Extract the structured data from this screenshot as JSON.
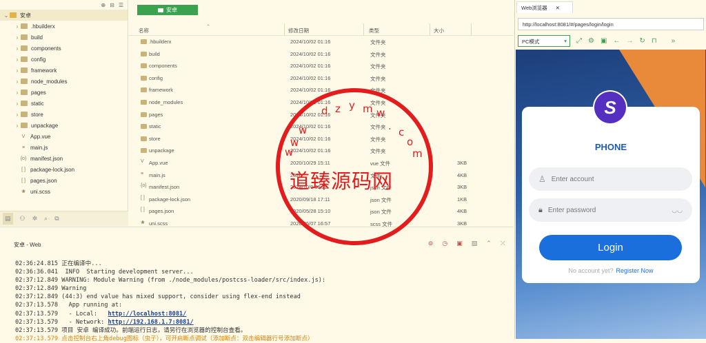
{
  "left_tree": {
    "root": "安卓",
    "items": [
      {
        "name": ".hbuilderx",
        "type": "folder"
      },
      {
        "name": "build",
        "type": "folder"
      },
      {
        "name": "components",
        "type": "folder"
      },
      {
        "name": "config",
        "type": "folder"
      },
      {
        "name": "framework",
        "type": "folder"
      },
      {
        "name": "node_modules",
        "type": "folder"
      },
      {
        "name": "pages",
        "type": "folder"
      },
      {
        "name": "static",
        "type": "folder"
      },
      {
        "name": "store",
        "type": "folder"
      },
      {
        "name": "unpackage",
        "type": "folder"
      },
      {
        "name": "App.vue",
        "type": "file",
        "icon": "V"
      },
      {
        "name": "main.js",
        "type": "file",
        "icon": "≡"
      },
      {
        "name": "manifest.json",
        "type": "file",
        "icon": "{o}"
      },
      {
        "name": "package-lock.json",
        "type": "file",
        "icon": "[ ]"
      },
      {
        "name": "pages.json",
        "type": "file",
        "icon": "[ ]"
      },
      {
        "name": "uni.scss",
        "type": "file",
        "icon": "❀"
      }
    ]
  },
  "center": {
    "tab_label": "安卓",
    "columns": {
      "name": "名称",
      "date": "修改日期",
      "type": "类型",
      "size": "大小"
    },
    "rows": [
      {
        "name": ".hbuilderx",
        "date": "2024/10/02 01:16",
        "type": "文件夹",
        "size": "",
        "kind": "folder"
      },
      {
        "name": "build",
        "date": "2024/10/02 01:16",
        "type": "文件夹",
        "size": "",
        "kind": "folder"
      },
      {
        "name": "components",
        "date": "2024/10/02 01:16",
        "type": "文件夹",
        "size": "",
        "kind": "folder"
      },
      {
        "name": "config",
        "date": "2024/10/02 01:16",
        "type": "文件夹",
        "size": "",
        "kind": "folder"
      },
      {
        "name": "framework",
        "date": "2024/10/02 01:16",
        "type": "文件夹",
        "size": "",
        "kind": "folder"
      },
      {
        "name": "node_modules",
        "date": "2024/10/02 01:16",
        "type": "文件夹",
        "size": "",
        "kind": "folder"
      },
      {
        "name": "pages",
        "date": "2024/10/02 01:16",
        "type": "文件夹",
        "size": "",
        "kind": "folder"
      },
      {
        "name": "static",
        "date": "2024/10/02 01:16",
        "type": "文件夹",
        "size": "",
        "kind": "folder"
      },
      {
        "name": "store",
        "date": "2024/10/02 01:16",
        "type": "文件夹",
        "size": "",
        "kind": "folder"
      },
      {
        "name": "unpackage",
        "date": "2024/10/02 01:16",
        "type": "文件夹",
        "size": "",
        "kind": "folder"
      },
      {
        "name": "App.vue",
        "date": "2020/10/29 15:11",
        "type": "vue 文件",
        "size": "3KB",
        "kind": "file",
        "icon": "V"
      },
      {
        "name": "main.js",
        "date": "2020/",
        "type": "文件",
        "size": "4KB",
        "kind": "file",
        "icon": "≡"
      },
      {
        "name": "manifest.json",
        "date": "2024/10/0 03:22",
        "type": "json 文件",
        "size": "3KB",
        "kind": "file",
        "icon": "{o}"
      },
      {
        "name": "package-lock.json",
        "date": "2020/09/18 17:11",
        "type": "json 文件",
        "size": "1KB",
        "kind": "file",
        "icon": "[ ]"
      },
      {
        "name": "pages.json",
        "date": "2020/05/28 15:10",
        "type": "json 文件",
        "size": "4KB",
        "kind": "file",
        "icon": "[ ]"
      },
      {
        "name": "uni.scss",
        "date": "2020/05/07 16:57",
        "type": "scss 文件",
        "size": "3KB",
        "kind": "file",
        "icon": "❀"
      }
    ]
  },
  "console": {
    "title": "安卓 - Web",
    "lines": [
      {
        "t": "02:36:24.815",
        "msg": " 正在编译中..."
      },
      {
        "t": "02:36:36.041",
        "msg": "  INFO  Starting development server..."
      },
      {
        "t": "02:37:12.849",
        "msg": " WARNING: Module Warning (from ./node_modules/postcss-loader/src/index.js):"
      },
      {
        "t": "02:37:12.849",
        "msg": " Warning"
      },
      {
        "t": "02:37:12.849",
        "msg": " (44:3) end value has mixed support, consider using flex-end instead"
      },
      {
        "t": "02:37:13.578",
        "msg": "   App running at:"
      },
      {
        "t": "02:37:13.579",
        "msg": "   - Local:   ",
        "link": "http://localhost:8081/"
      },
      {
        "t": "02:37:13.579",
        "msg": "   - Network: ",
        "link": "http://192.168.1.7:8081/"
      },
      {
        "t": "02:37:13.579",
        "msg": " 项目 安卓 编译成功。前端运行日志，请另行在浏览器的控制台查看。"
      },
      {
        "t": "02:37:13.579",
        "msg": " 点击控制台右上角debug图标（虫子），可开启断点调试（添加断点：双击编辑器行号添加断点）",
        "warn": true
      }
    ]
  },
  "browser": {
    "tab_label": "Web浏览器",
    "url": "http://localhost:8081/#/pages/login/login",
    "mode": "PC模式"
  },
  "login": {
    "avatar_letter": "S",
    "title": "PHONE",
    "account_placeholder": "Enter account",
    "password_placeholder": "Enter password",
    "button": "Login",
    "no_account": "No account yet?",
    "register": "Register Now"
  },
  "watermark": {
    "main": "道臻源码网",
    "letters": [
      "d",
      "z",
      "y",
      "m",
      "w",
      ".",
      "c",
      "o",
      "m",
      "w",
      "w",
      "w"
    ]
  },
  "colors": {
    "accent": "#3ba24f",
    "login_blue": "#1a6fdc",
    "stamp": "#e31d1d"
  }
}
